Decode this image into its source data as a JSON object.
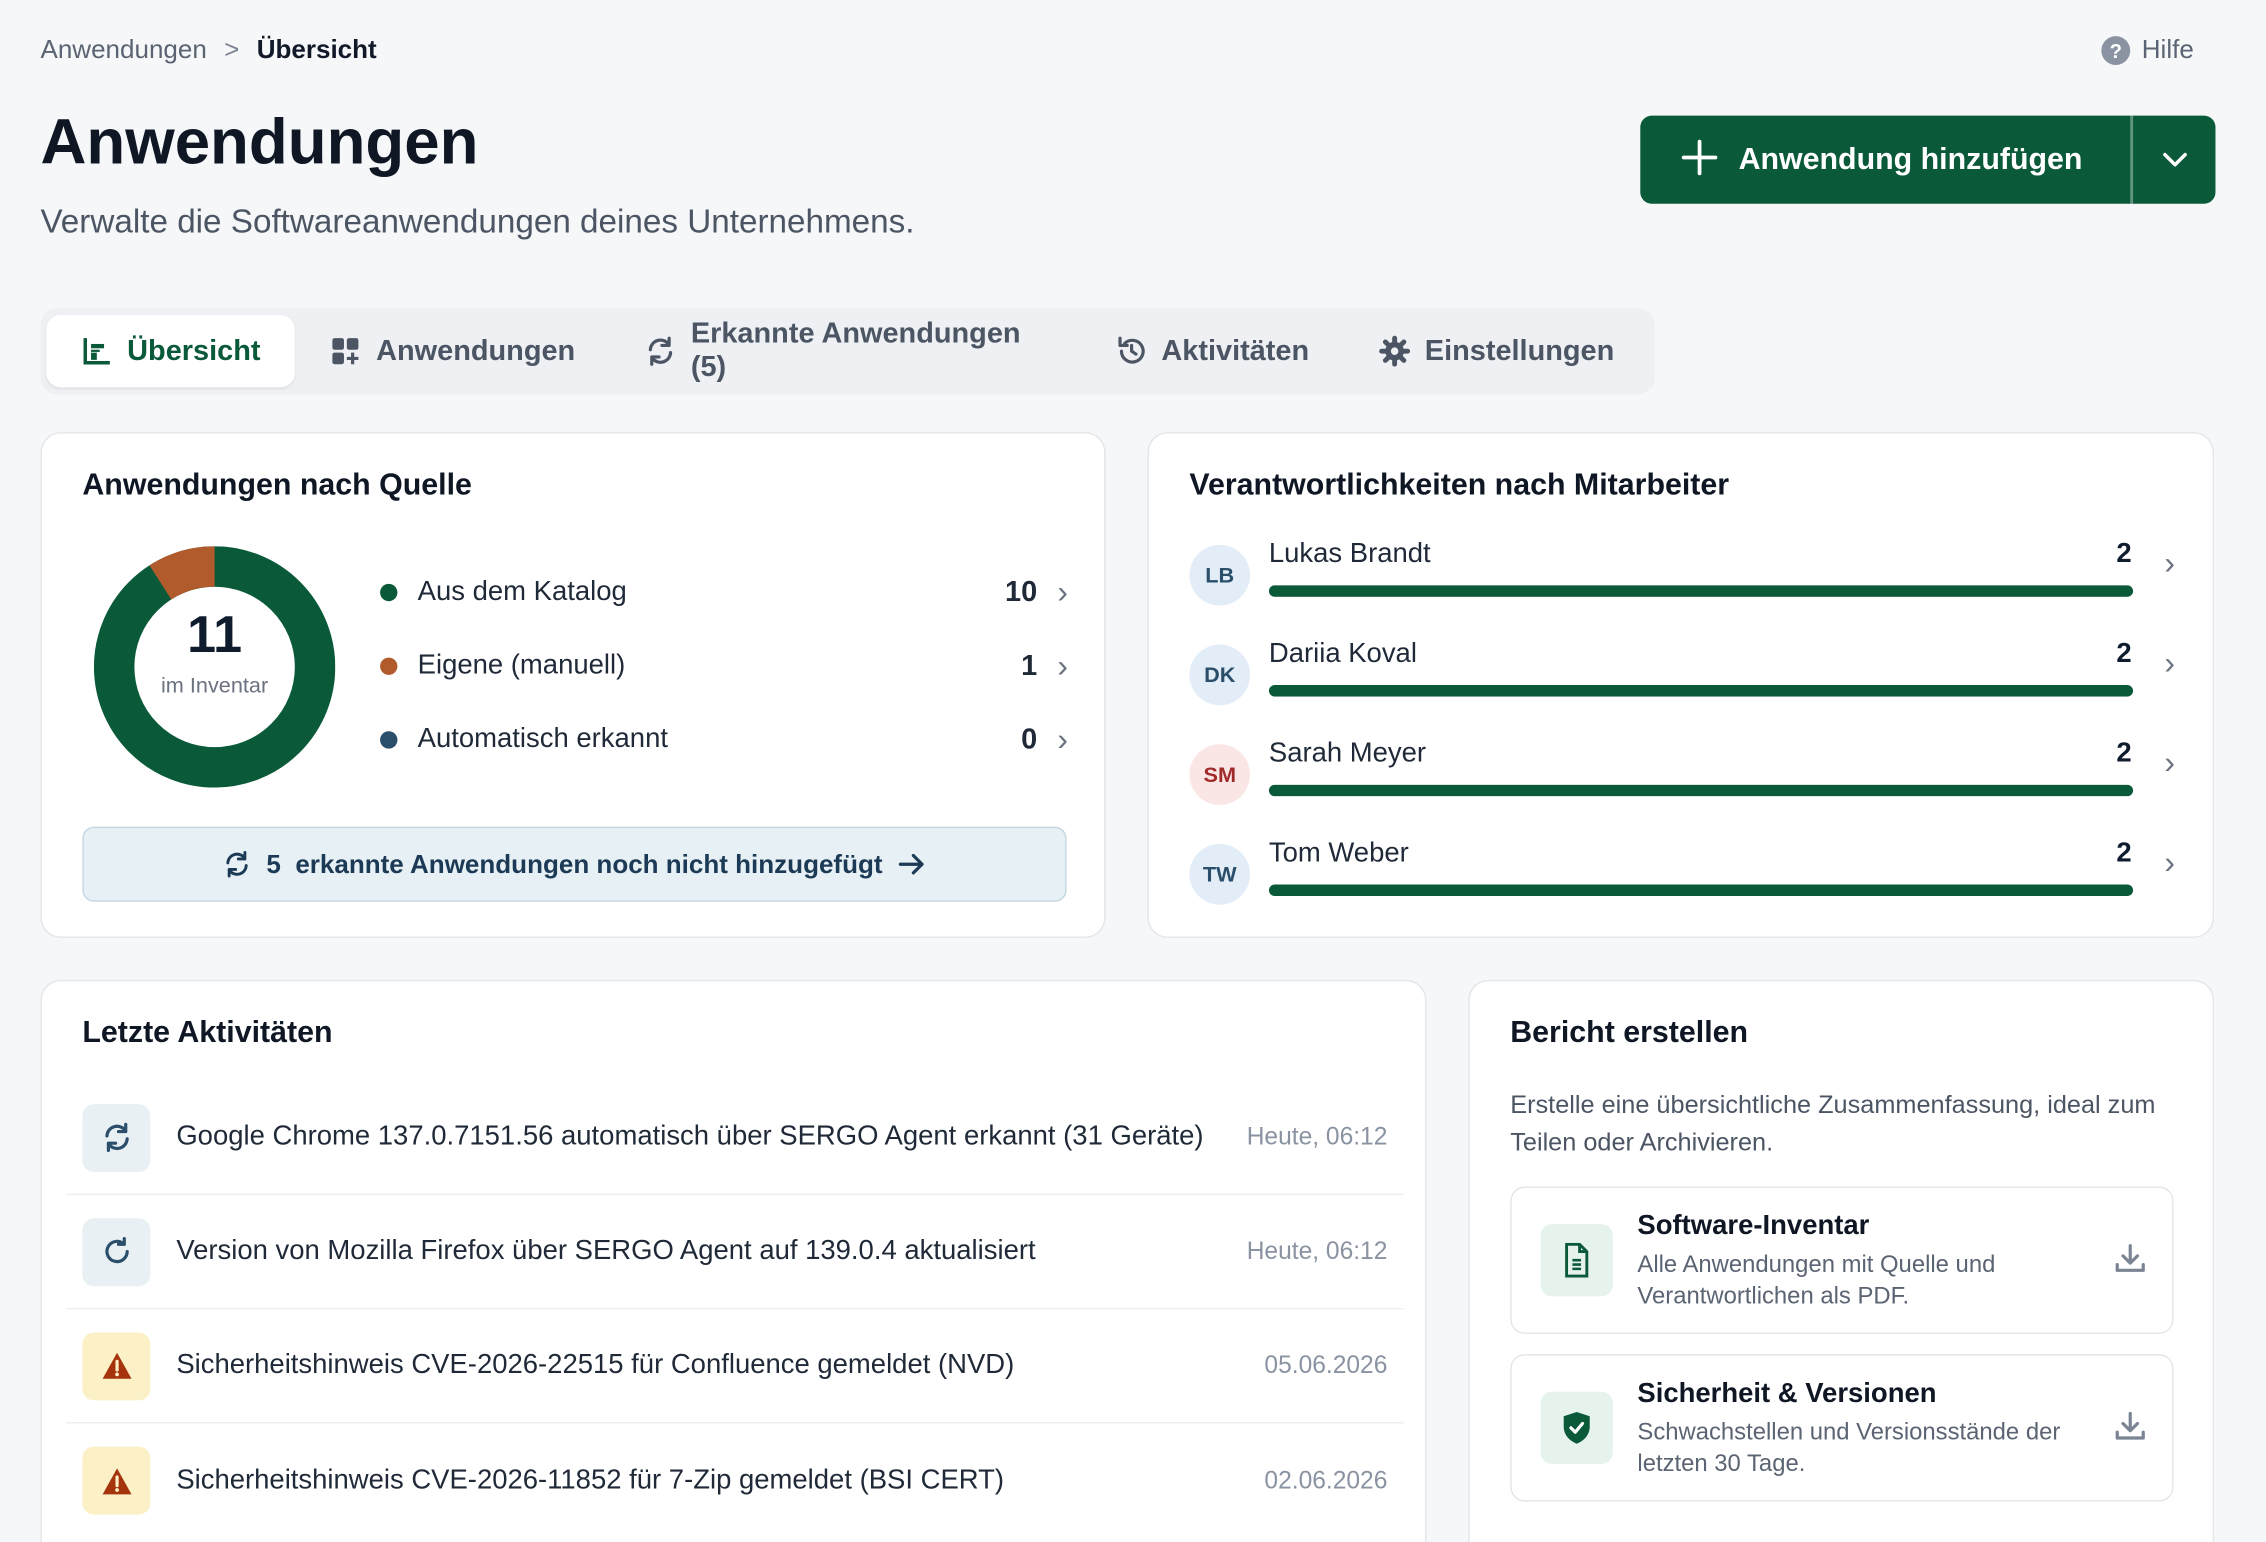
{
  "breadcrumb": {
    "parent": "Anwendungen",
    "separator": ">",
    "current": "Übersicht"
  },
  "help": {
    "label": "Hilfe"
  },
  "header": {
    "title": "Anwendungen",
    "subtitle": "Verwalte die Softwareanwendungen deines Unternehmens.",
    "add_button": "Anwendung hinzufügen"
  },
  "tabs": [
    {
      "label": "Übersicht",
      "icon": "chart-bar-icon"
    },
    {
      "label": "Anwendungen",
      "icon": "grid-add-icon"
    },
    {
      "label": "Erkannte Anwendungen (5)",
      "icon": "refresh-icon"
    },
    {
      "label": "Aktivitäten",
      "icon": "history-icon"
    },
    {
      "label": "Einstellungen",
      "icon": "gear-icon"
    }
  ],
  "sources": {
    "title": "Anwendungen nach Quelle",
    "total": "11",
    "total_label": "im Inventar",
    "items": [
      {
        "label": "Aus dem Katalog",
        "count": "10",
        "color": "#0a5a3a"
      },
      {
        "label": "Eigene (manuell)",
        "count": "1",
        "color": "#b15a2c"
      },
      {
        "label": "Automatisch erkannt",
        "count": "0",
        "color": "#2b4e6b"
      }
    ],
    "detected_count": "5",
    "detected_text": "erkannte Anwendungen noch nicht hinzugefügt"
  },
  "responsibilities": {
    "title": "Verantwortlichkeiten nach Mitarbeiter",
    "people": [
      {
        "initials": "LB",
        "name": "Lukas Brandt",
        "count": "2",
        "fill": 1.0,
        "bg": "#e3edf7",
        "fg": "#2b4e6b"
      },
      {
        "initials": "DK",
        "name": "Dariia Koval",
        "count": "2",
        "fill": 1.0,
        "bg": "#e3edf7",
        "fg": "#2b4e6b"
      },
      {
        "initials": "SM",
        "name": "Sarah Meyer",
        "count": "2",
        "fill": 1.0,
        "bg": "#fbe6e6",
        "fg": "#a12b2b"
      },
      {
        "initials": "TW",
        "name": "Tom Weber",
        "count": "2",
        "fill": 1.0,
        "bg": "#e3edf7",
        "fg": "#2b4e6b"
      }
    ]
  },
  "activities": {
    "title": "Letzte Aktivitäten",
    "items": [
      {
        "type": "info",
        "icon": "sync-icon",
        "text": "Google Chrome 137.0.7151.56 automatisch über SERGO Agent erkannt (31 Geräte)",
        "time": "Heute, 06:12"
      },
      {
        "type": "info",
        "icon": "update-icon",
        "text": "Version von Mozilla Firefox über SERGO Agent auf 139.0.4 aktualisiert",
        "time": "Heute, 06:12"
      },
      {
        "type": "warn",
        "icon": "warning-icon",
        "text": "Sicherheitshinweis CVE-2026-22515 für Confluence gemeldet (NVD)",
        "time": "05.06.2026"
      },
      {
        "type": "warn",
        "icon": "warning-icon",
        "text": "Sicherheitshinweis CVE-2026-11852 für 7-Zip gemeldet (BSI CERT)",
        "time": "02.06.2026"
      }
    ]
  },
  "report": {
    "title": "Bericht erstellen",
    "description": "Erstelle eine übersichtliche Zusammenfassung, ideal zum Teilen oder Archivieren.",
    "items": [
      {
        "title": "Software-Inventar",
        "desc": "Alle Anwendungen mit Quelle und Verantwortlichen als PDF.",
        "icon": "document-icon"
      },
      {
        "title": "Sicherheit & Versionen",
        "desc": "Schwachstellen und Versionsstände der letzten 30 Tage.",
        "icon": "shield-check-icon"
      }
    ]
  }
}
